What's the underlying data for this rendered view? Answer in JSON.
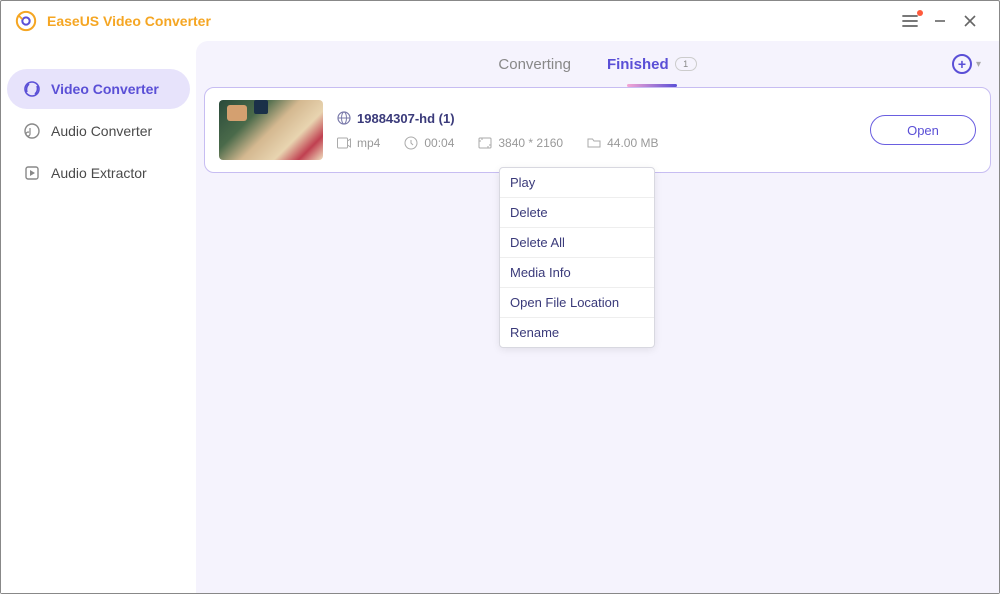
{
  "app": {
    "title": "EaseUS Video Converter"
  },
  "sidebar": {
    "items": [
      {
        "label": "Video Converter"
      },
      {
        "label": "Audio Converter"
      },
      {
        "label": "Audio Extractor"
      }
    ]
  },
  "tabs": {
    "converting": "Converting",
    "finished": "Finished",
    "finished_count": "1"
  },
  "file": {
    "name": "19884307-hd (1)",
    "format": "mp4",
    "duration": "00:04",
    "resolution": "3840 * 2160",
    "size": "44.00 MB",
    "open_label": "Open"
  },
  "context_menu": {
    "items": [
      {
        "label": "Play"
      },
      {
        "label": "Delete"
      },
      {
        "label": "Delete All"
      },
      {
        "label": "Media Info"
      },
      {
        "label": "Open File Location"
      },
      {
        "label": "Rename"
      }
    ]
  }
}
